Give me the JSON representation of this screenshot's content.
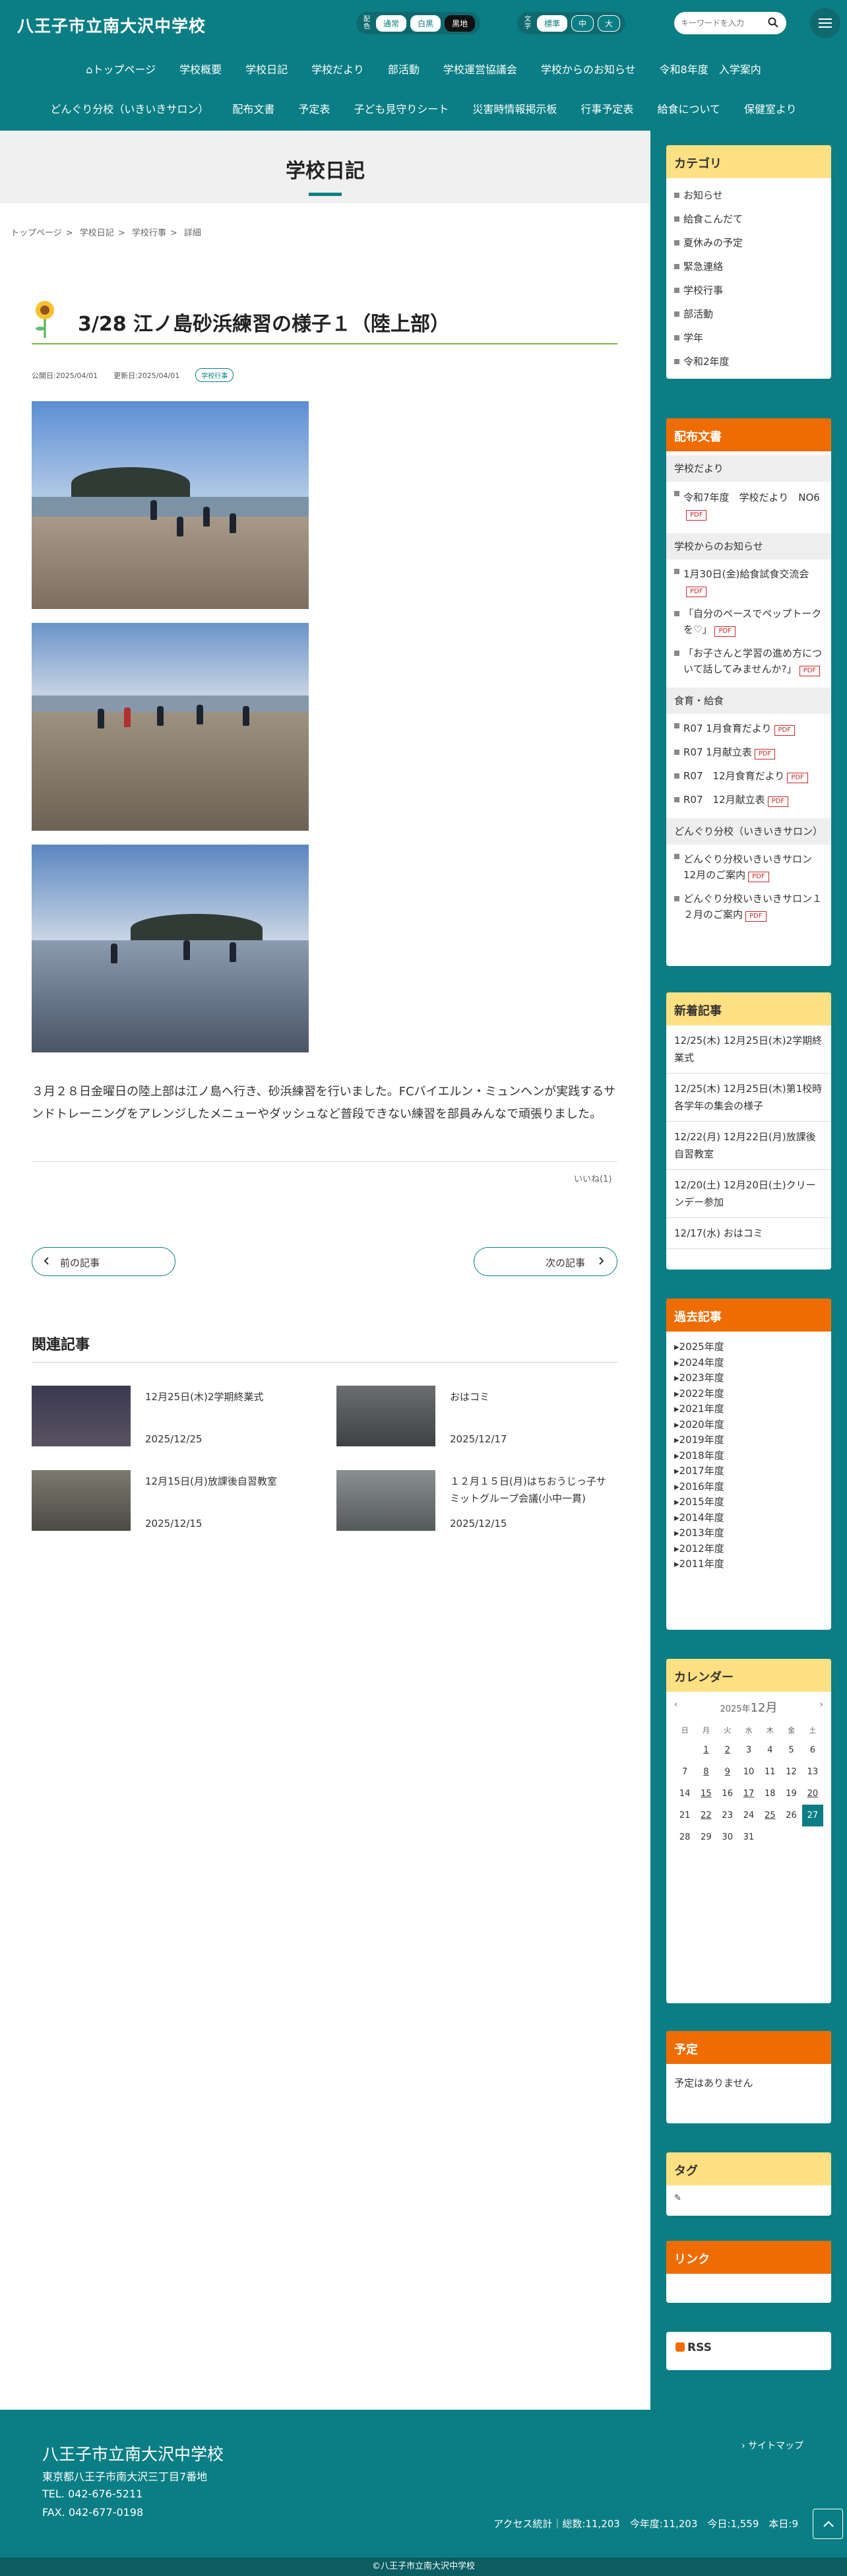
{
  "header": {
    "site_title": "八王子市立南大沢中学校",
    "color_label": "配色",
    "color_options": [
      "通常",
      "白黒",
      "黒地"
    ],
    "font_label": "文字",
    "font_options": [
      "標準",
      "中",
      "大"
    ],
    "search_placeholder": "キーワードを入力"
  },
  "nav": {
    "row1": [
      "トップページ",
      "学校概要",
      "学校日記",
      "学校だより",
      "部活動",
      "学校運営協議会",
      "学校からのお知らせ",
      "令和8年度　入学案内"
    ],
    "row2": [
      "どんぐり分校（いきいきサロン）",
      "配布文書",
      "予定表",
      "子ども見守りシート",
      "災害時情報掲示板",
      "行事予定表",
      "給食について",
      "保健室より"
    ]
  },
  "page": {
    "heading": "学校日記",
    "breadcrumb": [
      "トップページ",
      "学校日記",
      "学校行事",
      "詳細"
    ],
    "article_title": "3/28 江ノ島砂浜練習の様子１（陸上部）",
    "published": "公開日:2025/04/01",
    "updated": "更新日:2025/04/01",
    "tag": "学校行事",
    "body": "３月２８日金曜日の陸上部は江ノ島へ行き、砂浜練習を行いました。FCバイエルン・ミュンヘンが実践するサンドトレーニングをアレンジしたメニューやダッシュなど普段できない練習を部員みんなで頑張りました。",
    "like": "いいね(1)",
    "prev": "前の記事",
    "next": "次の記事",
    "related_heading": "関連記事",
    "related": [
      {
        "title": "12月25日(木)2学期終業式",
        "date": "2025/12/25"
      },
      {
        "title": "おはコミ",
        "date": "2025/12/17"
      },
      {
        "title": "12月15日(月)放課後自習教室",
        "date": "2025/12/15"
      },
      {
        "title": "１２月１５日(月)はちおうじっ子サミットグループ会議(小中一貫)",
        "date": "2025/12/15"
      }
    ]
  },
  "sidebar": {
    "category_title": "カテゴリ",
    "categories": [
      "お知らせ",
      "給食こんだて",
      "夏休みの予定",
      "緊急連絡",
      "学校行事",
      "部活動",
      "学年",
      "令和2年度"
    ],
    "docs_title": "配布文書",
    "doc_groups": [
      {
        "name": "学校だより",
        "items": [
          "令和7年度　学校だより　NO6"
        ]
      },
      {
        "name": "学校からのお知らせ",
        "items": [
          "1月30日(金)給食試食交流会",
          "「自分のペースでペップトークを♡」",
          "「お子さんと学習の進め方について話してみませんか?」"
        ]
      },
      {
        "name": "食育・給食",
        "items": [
          "R07 1月食育だより",
          "R07 1月献立表",
          "R07　12月食育だより",
          "R07　12月献立表"
        ]
      },
      {
        "name": "どんぐり分校（いきいきサロン）",
        "items": [
          "どんぐり分校いきいきサロン12月のご案内",
          "どんぐり分校いきいきサロン１２月のご案内"
        ]
      }
    ],
    "pdf_label": "PDF",
    "new_title": "新着記事",
    "new_items": [
      "12/25(木) 12月25日(木)2学期終業式",
      "12/25(木) 12月25日(木)第1校時　各学年の集会の様子",
      "12/22(月) 12月22日(月)放課後自習教室",
      "12/20(土) 12月20日(土)クリーンデー参加",
      "12/17(水) おはコミ"
    ],
    "past_title": "過去記事",
    "years": [
      "2025年度",
      "2024年度",
      "2023年度",
      "2022年度",
      "2021年度",
      "2020年度",
      "2019年度",
      "2018年度",
      "2017年度",
      "2016年度",
      "2015年度",
      "2014年度",
      "2013年度",
      "2012年度",
      "2011年度"
    ],
    "calendar_title": "カレンダー",
    "cal_year": "2025年",
    "cal_month": "12月",
    "weekdays": [
      "日",
      "月",
      "火",
      "水",
      "木",
      "金",
      "土"
    ],
    "days": [
      "",
      "1",
      "2",
      "3",
      "4",
      "5",
      "6",
      "7",
      "8",
      "9",
      "10",
      "11",
      "12",
      "13",
      "14",
      "15",
      "16",
      "17",
      "18",
      "19",
      "20",
      "21",
      "22",
      "23",
      "24",
      "25",
      "26",
      "27",
      "28",
      "29",
      "30",
      "31",
      "",
      "",
      ""
    ],
    "linked_days": [
      "1",
      "2",
      "8",
      "9",
      "15",
      "17",
      "20",
      "22",
      "25"
    ],
    "today": "27",
    "schedule_title": "予定",
    "schedule_text": "予定はありません",
    "tag_title": "タグ",
    "link_title": "リンク",
    "rss": "RSS"
  },
  "footer": {
    "name": "八王子市立南大沢中学校",
    "address": "東京都八王子市南大沢三丁目7番地",
    "tel": "TEL. 042-676-5211",
    "fax": "FAX. 042-677-0198",
    "sitemap": "サイトマップ",
    "stats": "アクセス統計｜総数:11,203　今年度:11,203　今日:1,559　本日:9",
    "copyright": "©八王子市立南大沢中学校"
  },
  "colors": {
    "brand": "#0a7e84",
    "accent_yellow": "#ffe082",
    "accent_orange": "#ef6c00"
  }
}
